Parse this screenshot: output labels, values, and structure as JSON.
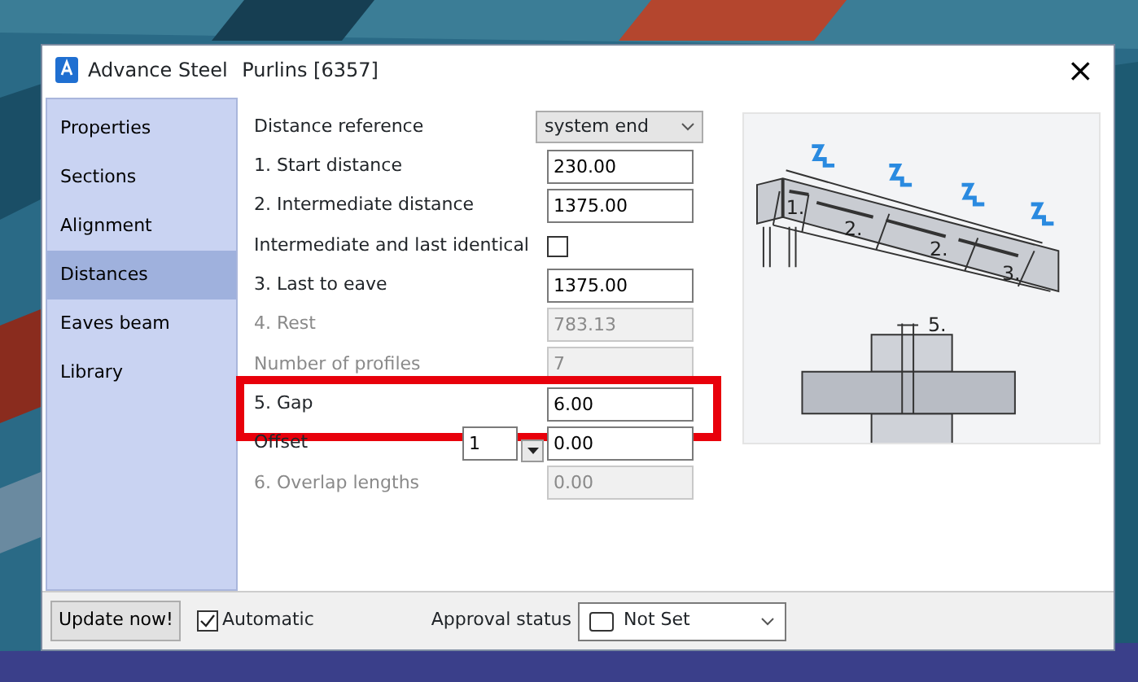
{
  "window": {
    "title_app": "Advance Steel",
    "title": "Purlins [6357]",
    "close": "×"
  },
  "sidebar": {
    "items": [
      {
        "label": "Properties",
        "selected": false
      },
      {
        "label": "Sections",
        "selected": false
      },
      {
        "label": "Alignment",
        "selected": false
      },
      {
        "label": "Distances",
        "selected": true
      },
      {
        "label": "Eaves beam",
        "selected": false
      },
      {
        "label": "Library",
        "selected": false
      }
    ]
  },
  "form": {
    "rows": [
      {
        "kind": "select",
        "label": "Distance reference",
        "value": "system end",
        "disabled": false,
        "highlighted": false
      },
      {
        "kind": "input",
        "label": "1. Start distance",
        "value": "230.00",
        "disabled": false,
        "highlighted": false
      },
      {
        "kind": "input",
        "label": "2. Intermediate distance",
        "value": "1375.00",
        "disabled": false,
        "highlighted": false
      },
      {
        "kind": "checkbox",
        "label": "Intermediate and last identical",
        "checked": false,
        "disabled": false,
        "highlighted": false
      },
      {
        "kind": "input",
        "label": "3. Last to eave",
        "value": "1375.00",
        "disabled": false,
        "highlighted": false
      },
      {
        "kind": "input",
        "label": "4. Rest",
        "value": "783.13",
        "disabled": true,
        "highlighted": false
      },
      {
        "kind": "input",
        "label": "Number of profiles",
        "value": "7",
        "disabled": true,
        "highlighted": false
      },
      {
        "kind": "input",
        "label": "5. Gap",
        "value": "6.00",
        "disabled": false,
        "highlighted": true
      },
      {
        "kind": "spinner",
        "label": "Offset",
        "spin_value": "1",
        "value": "0.00",
        "disabled": false,
        "highlighted": false
      },
      {
        "kind": "input",
        "label": "6. Overlap lengths",
        "value": "0.00",
        "disabled": true,
        "highlighted": false
      }
    ]
  },
  "diagram": {
    "labels": [
      "1.",
      "2.",
      "2.",
      "3.",
      "5."
    ]
  },
  "footer": {
    "update_button": "Update now!",
    "automatic": {
      "label": "Automatic",
      "checked": true
    },
    "approval_label": "Approval status",
    "approval_value": "Not Set"
  }
}
